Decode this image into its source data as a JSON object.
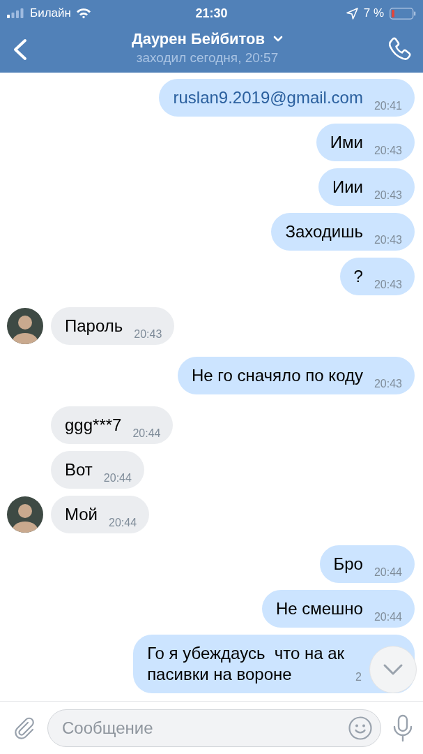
{
  "status_bar": {
    "carrier": "Билайн",
    "time": "21:30",
    "battery": "7 %"
  },
  "header": {
    "title": "Даурен Бейбитов",
    "subtitle": "заходил сегодня, 20:57"
  },
  "messages": [
    {
      "outgoing": true,
      "kind": "link",
      "text": "ruslan9.2019@gmail.com",
      "time": "20:41",
      "avatar": false
    },
    {
      "outgoing": true,
      "kind": "text",
      "text": "Ими",
      "time": "20:43",
      "avatar": false
    },
    {
      "outgoing": true,
      "kind": "text",
      "text": "Иии",
      "time": "20:43",
      "avatar": false
    },
    {
      "outgoing": true,
      "kind": "text",
      "text": "Заходишь",
      "time": "20:43",
      "avatar": false
    },
    {
      "outgoing": true,
      "kind": "text",
      "text": "?",
      "time": "20:43",
      "avatar": false
    },
    {
      "outgoing": false,
      "kind": "text",
      "text": "Пароль",
      "time": "20:43",
      "avatar": true
    },
    {
      "outgoing": true,
      "kind": "text",
      "text": "Не го сначяло по коду",
      "time": "20:43",
      "avatar": false
    },
    {
      "outgoing": false,
      "kind": "text",
      "text": "ggg***7",
      "time": "20:44",
      "avatar": false
    },
    {
      "outgoing": false,
      "kind": "text",
      "text": "Вот",
      "time": "20:44",
      "avatar": false
    },
    {
      "outgoing": false,
      "kind": "text",
      "text": "Мой",
      "time": "20:44",
      "avatar": true
    },
    {
      "outgoing": true,
      "kind": "text",
      "text": "Бро",
      "time": "20:44",
      "avatar": false
    },
    {
      "outgoing": true,
      "kind": "text",
      "text": "Не смешно",
      "time": "20:44",
      "avatar": false
    },
    {
      "outgoing": true,
      "kind": "text",
      "text": "Го я убеждаусь  что на ак\nпасивки на вороне",
      "time": "2",
      "avatar": false
    }
  ],
  "composer": {
    "placeholder": "Сообщение"
  }
}
